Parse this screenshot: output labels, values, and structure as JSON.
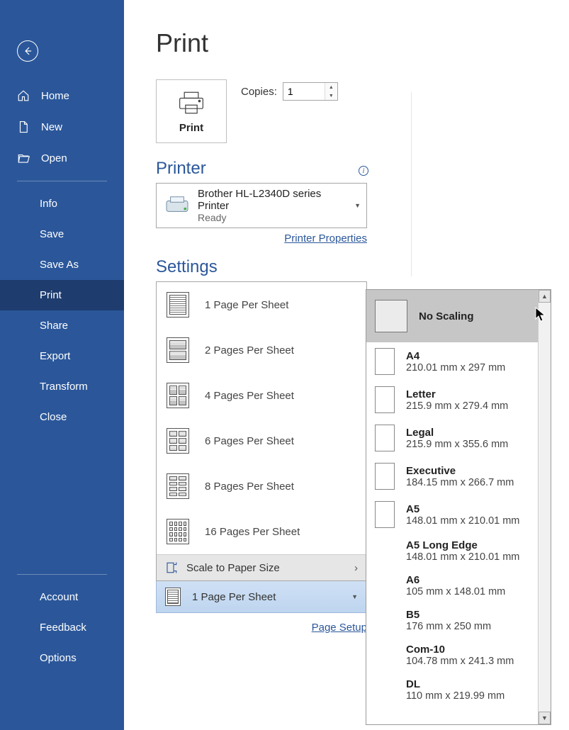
{
  "sidebar": {
    "top": [
      {
        "label": "Home",
        "icon": "home"
      },
      {
        "label": "New",
        "icon": "new"
      },
      {
        "label": "Open",
        "icon": "open"
      }
    ],
    "middle": [
      "Info",
      "Save",
      "Save As",
      "Print",
      "Share",
      "Export",
      "Transform",
      "Close"
    ],
    "bottom": [
      "Account",
      "Feedback",
      "Options"
    ],
    "active": "Print"
  },
  "page_title": "Print",
  "print_button_label": "Print",
  "copies_label": "Copies:",
  "copies_value": "1",
  "printer_section_label": "Printer",
  "printer": {
    "name": "Brother HL-L2340D series Printer",
    "status": "Ready"
  },
  "printer_properties_label": "Printer Properties",
  "settings_section_label": "Settings",
  "pages_per_sheet_options": [
    {
      "label": "1 Page Per Sheet",
      "grid": "g1"
    },
    {
      "label": "2 Pages Per Sheet",
      "grid": "g2"
    },
    {
      "label": "4 Pages Per Sheet",
      "grid": "g4"
    },
    {
      "label": "6 Pages Per Sheet",
      "grid": "g6"
    },
    {
      "label": "8 Pages Per Sheet",
      "grid": "g8"
    },
    {
      "label": "16 Pages Per Sheet",
      "grid": "g16"
    }
  ],
  "scale_to_paper_label": "Scale to Paper Size",
  "selected_pages_per_sheet": "1 Page Per Sheet",
  "page_setup_label": "Page Setup",
  "paper_sizes": [
    {
      "title": "No Scaling",
      "dims": "",
      "hover": true,
      "thumb": true
    },
    {
      "title": "A4",
      "dims": "210.01 mm x 297 mm",
      "thumb": true
    },
    {
      "title": "Letter",
      "dims": "215.9 mm x 279.4 mm",
      "thumb": true
    },
    {
      "title": "Legal",
      "dims": "215.9 mm x 355.6 mm",
      "thumb": true
    },
    {
      "title": "Executive",
      "dims": "184.15 mm x 266.7 mm",
      "thumb": true
    },
    {
      "title": "A5",
      "dims": "148.01 mm x 210.01 mm",
      "thumb": true
    },
    {
      "title": "A5 Long Edge",
      "dims": "148.01 mm x 210.01 mm",
      "thumb": false
    },
    {
      "title": "A6",
      "dims": "105 mm x 148.01 mm",
      "thumb": false
    },
    {
      "title": "B5",
      "dims": "176 mm x 250 mm",
      "thumb": false
    },
    {
      "title": "Com-10",
      "dims": "104.78 mm x 241.3 mm",
      "thumb": false
    },
    {
      "title": "DL",
      "dims": "110 mm x 219.99 mm",
      "thumb": false
    }
  ]
}
